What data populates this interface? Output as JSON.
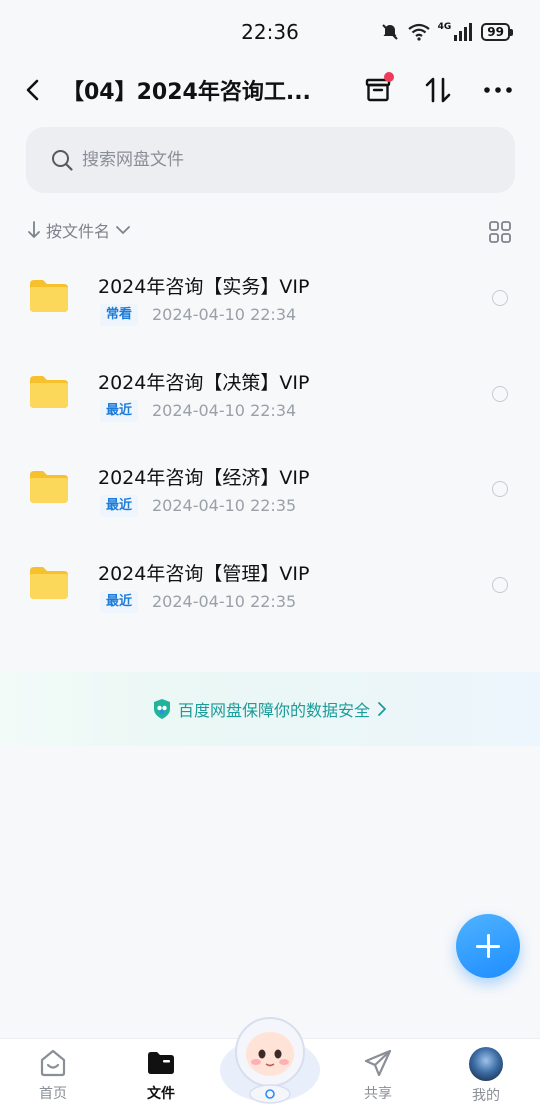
{
  "status_bar": {
    "time": "22:36",
    "network": "4G",
    "battery": "99"
  },
  "header": {
    "title": "【04】2024年咨询工..."
  },
  "search": {
    "placeholder": "搜索网盘文件"
  },
  "sort": {
    "label": "按文件名"
  },
  "files": [
    {
      "name": "2024年咨询【实务】VIP",
      "tag": "常看",
      "date": "2024-04-10  22:34"
    },
    {
      "name": "2024年咨询【决策】VIP",
      "tag": "最近",
      "date": "2024-04-10  22:34"
    },
    {
      "name": "2024年咨询【经济】VIP",
      "tag": "最近",
      "date": "2024-04-10  22:35"
    },
    {
      "name": "2024年咨询【管理】VIP",
      "tag": "最近",
      "date": "2024-04-10  22:35"
    }
  ],
  "banner": {
    "text": "百度网盘保障你的数据安全"
  },
  "tabs": [
    {
      "label": "首页"
    },
    {
      "label": "文件"
    },
    {
      "label": "共享"
    },
    {
      "label": "我的"
    }
  ],
  "colors": {
    "accent": "#1e8dff",
    "tag_text": "#1d7bd9",
    "safety_text": "#1b9c9a",
    "badge": "#ef3b5a",
    "folder": "#fcd344"
  }
}
